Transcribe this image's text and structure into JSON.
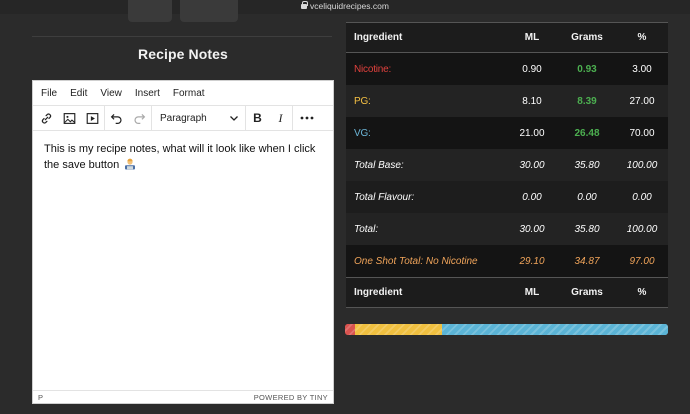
{
  "browser": {
    "url": "vceliquidrecipes.com"
  },
  "notes": {
    "title": "Recipe Notes"
  },
  "editor": {
    "menu": [
      "File",
      "Edit",
      "View",
      "Insert",
      "Format"
    ],
    "block_format": "Paragraph",
    "content": "This is my recipe notes, what will it look like when I click the save button",
    "status_path": "P",
    "branding": "POWERED BY TINY"
  },
  "table": {
    "headers": {
      "ingredient": "Ingredient",
      "ml": "ML",
      "grams": "Grams",
      "pct": "%"
    },
    "rows": [
      {
        "name": "Nicotine:",
        "ml": "0.90",
        "grams": "0.93",
        "pct": "3.00"
      },
      {
        "name": "PG:",
        "ml": "8.10",
        "grams": "8.39",
        "pct": "27.00"
      },
      {
        "name": "VG:",
        "ml": "21.00",
        "grams": "26.48",
        "pct": "70.00"
      },
      {
        "name": "Total Base:",
        "ml": "30.00",
        "grams": "35.80",
        "pct": "100.00"
      },
      {
        "name": "Total Flavour:",
        "ml": "0.00",
        "grams": "0.00",
        "pct": "0.00"
      },
      {
        "name": "Total:",
        "ml": "30.00",
        "grams": "35.80",
        "pct": "100.00"
      },
      {
        "name": "One Shot Total: No Nicotine",
        "ml": "29.10",
        "grams": "34.87",
        "pct": "97.00"
      }
    ]
  },
  "mix_bar": {
    "segments": [
      {
        "label": "Nicotine",
        "percent": 3,
        "color": "#d9534f"
      },
      {
        "label": "PG",
        "percent": 27,
        "color": "#f0c040"
      },
      {
        "label": "VG",
        "percent": 70,
        "color": "#5bb4d6"
      }
    ]
  },
  "colors": {
    "nicotine": "#e0413d",
    "pg": "#f5c043",
    "vg": "#6cb6d8",
    "grams_green": "#4caf50",
    "one_shot": "#f0a45a"
  }
}
